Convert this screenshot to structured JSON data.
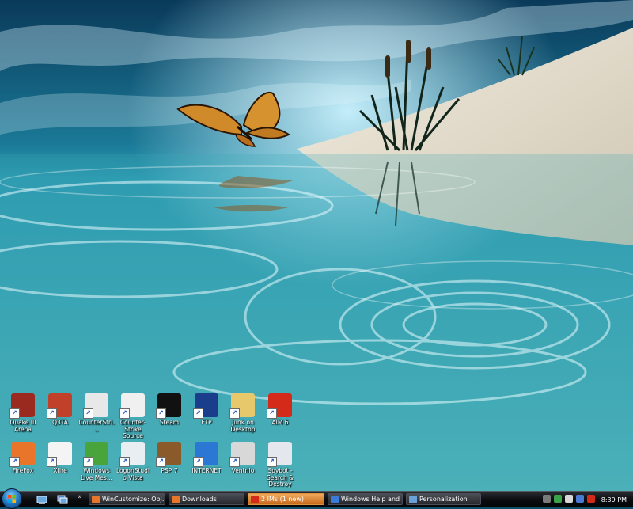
{
  "desktop": {
    "icons": [
      {
        "label": "Quake III Arena",
        "icon": "quake-icon",
        "color": "#9a2a20"
      },
      {
        "label": "Q3TA",
        "icon": "q3ta-icon",
        "color": "#c0402a"
      },
      {
        "label": "CounterStri...",
        "icon": "counterstrike-icon",
        "color": "#e8e8e8"
      },
      {
        "label": "Counter-Strike Source",
        "icon": "counterstrike-source-icon",
        "color": "#f0f0f0"
      },
      {
        "label": "Steam",
        "icon": "steam-icon",
        "color": "#111111"
      },
      {
        "label": "FTP",
        "icon": "full-tilt-poker-icon",
        "color": "#1a3d8c"
      },
      {
        "label": "Junk on Desktop",
        "icon": "folder-icon",
        "color": "#e7c86a"
      },
      {
        "label": "AIM 6",
        "icon": "aim-icon",
        "color": "#d42a1a"
      },
      {
        "label": "FireFox",
        "icon": "firefox-icon",
        "color": "#e8752a"
      },
      {
        "label": "Xfire",
        "icon": "xfire-icon",
        "color": "#f4f4f4"
      },
      {
        "label": "Windows Live Mes...",
        "icon": "windows-live-messenger-icon",
        "color": "#4aa43c"
      },
      {
        "label": "LogonStudio Vista",
        "icon": "logonstudio-icon",
        "color": "#e9eef3"
      },
      {
        "label": "PSP 7",
        "icon": "psp-icon",
        "color": "#8a5a2a"
      },
      {
        "label": "INTERNET",
        "icon": "internet-explorer-icon",
        "color": "#2a78d4"
      },
      {
        "label": "Ventrilo",
        "icon": "ventrilo-icon",
        "color": "#d8d8d8"
      },
      {
        "label": "Spybot - Search & Destroy",
        "icon": "spybot-icon",
        "color": "#e4e8ee"
      }
    ]
  },
  "taskbar": {
    "tasks": [
      {
        "label": "WinCustomize: Obj...",
        "icon": "firefox-icon",
        "color": "#e8752a",
        "flash": false
      },
      {
        "label": "Downloads",
        "icon": "firefox-icon",
        "color": "#e8752a",
        "flash": false
      },
      {
        "label": "2 IMs (1 new)",
        "icon": "aim-icon",
        "color": "#d42a1a",
        "flash": true
      },
      {
        "label": "Windows Help and ...",
        "icon": "help-icon",
        "color": "#3a7ad8",
        "flash": false
      },
      {
        "label": "Personalization",
        "icon": "control-panel-icon",
        "color": "#6aa0d8",
        "flash": false
      }
    ],
    "quicklaunch_more": "»",
    "clock": "8:39 PM"
  }
}
